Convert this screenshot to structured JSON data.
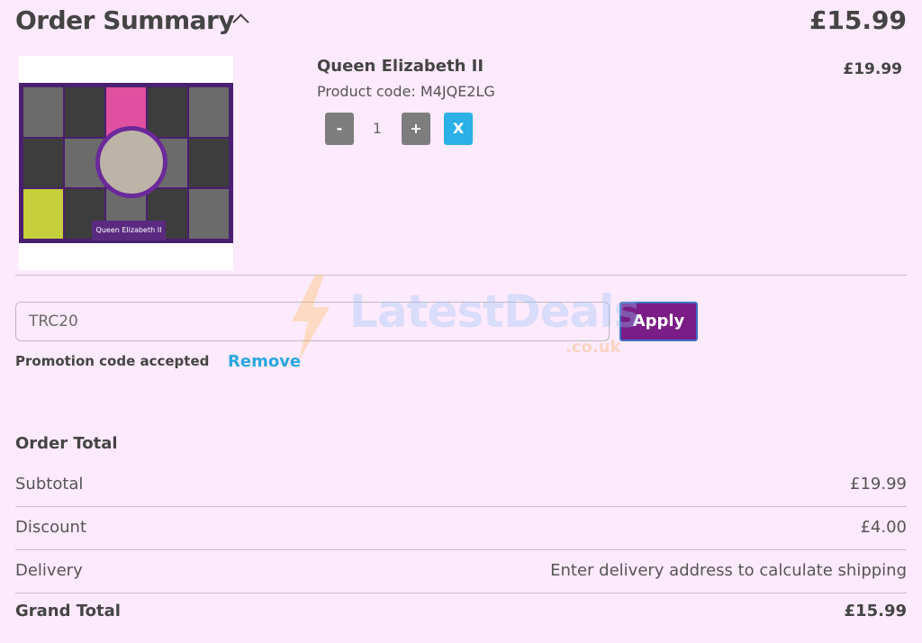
{
  "header": {
    "title": "Order Summary",
    "total": "£15.99"
  },
  "product": {
    "name": "Queen Elizabeth II",
    "code": "Product code: M4JQE2LG",
    "price": "£19.99",
    "quantity": "1",
    "thumb_caption": "Queen Elizabeth II"
  },
  "qty_controls": {
    "minus": "-",
    "plus": "+",
    "remove": "X"
  },
  "promo": {
    "value": "TRC20",
    "apply_label": "Apply",
    "message": "Promotion code  accepted",
    "remove_label": "Remove"
  },
  "watermark": {
    "main": "LatestDeals",
    "sub": ".co.uk"
  },
  "totals": {
    "heading": "Order Total",
    "rows": [
      {
        "label": "Subtotal",
        "value": "£19.99"
      },
      {
        "label": "Discount",
        "value": "£4.00"
      },
      {
        "label": "Delivery",
        "value": "Enter delivery address to calculate shipping"
      }
    ],
    "grand": {
      "label": "Grand Total",
      "value": "£15.99"
    }
  },
  "colors": {
    "background": "#fdeafc",
    "apply": "#7a1d86",
    "remove": "#2aa8e0",
    "delete_button": "#2bb1e6"
  }
}
